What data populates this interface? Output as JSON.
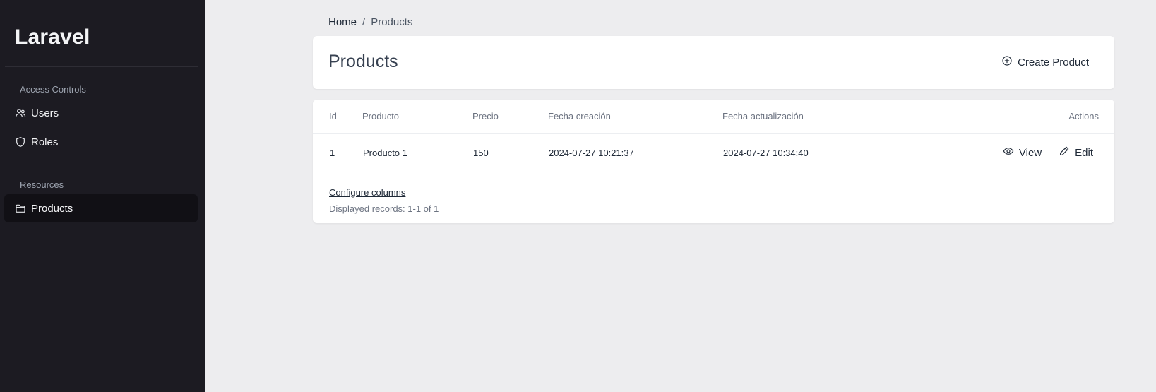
{
  "sidebar": {
    "brand": "Laravel",
    "sections": [
      {
        "title": "Access Controls",
        "items": [
          {
            "label": "Users",
            "icon": "users-icon"
          },
          {
            "label": "Roles",
            "icon": "shield-icon"
          }
        ]
      },
      {
        "title": "Resources",
        "items": [
          {
            "label": "Products",
            "icon": "folder-icon",
            "active": true
          }
        ]
      }
    ]
  },
  "breadcrumb": {
    "home": "Home",
    "separator": "/",
    "current": "Products"
  },
  "header": {
    "title": "Products",
    "create_label": "Create Product"
  },
  "table": {
    "columns": [
      "Id",
      "Producto",
      "Precio",
      "Fecha creación",
      "Fecha actualización",
      "Actions"
    ],
    "rows": [
      {
        "id": "1",
        "producto": "Producto 1",
        "precio": "150",
        "created": "2024-07-27 10:21:37",
        "updated": "2024-07-27 10:34:40",
        "view_label": "View",
        "edit_label": "Edit"
      }
    ],
    "configure_label": "Configure columns",
    "records_text": "Displayed records: 1-1 of 1"
  },
  "colors": {
    "sidebar_bg": "#1c1b22",
    "sidebar_active": "#111015",
    "page_bg": "#ededef",
    "card_bg": "#ffffff"
  }
}
